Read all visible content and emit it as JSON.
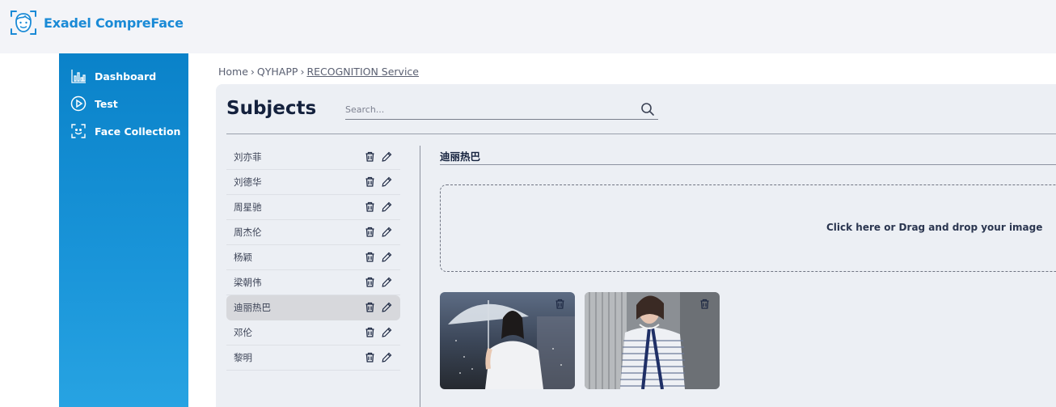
{
  "app": {
    "brand_name": "Exadel CompreFace",
    "brand_color": "#1a8ad6"
  },
  "sidebar": {
    "items": [
      {
        "label": "Dashboard",
        "icon": "chart-icon"
      },
      {
        "label": "Test",
        "icon": "play-icon"
      },
      {
        "label": "Face Collection",
        "icon": "face-scan-icon"
      }
    ]
  },
  "breadcrumb": {
    "home": "Home",
    "app": "QYHAPP",
    "service": "RECOGNITION Service",
    "separator": "›"
  },
  "subjects": {
    "title": "Subjects",
    "search_placeholder": "Search...",
    "items": [
      {
        "name": "刘亦菲"
      },
      {
        "name": "刘德华"
      },
      {
        "name": "周星驰"
      },
      {
        "name": "周杰伦"
      },
      {
        "name": "杨颖"
      },
      {
        "name": "梁朝伟"
      },
      {
        "name": "迪丽热巴"
      },
      {
        "name": "邓伦"
      },
      {
        "name": "黎明"
      }
    ],
    "selected_index": 6
  },
  "detail": {
    "subject_name": "迪丽热巴",
    "dropzone_text": "Click here or Drag and drop your image",
    "images": [
      {
        "description": "woman-with-umbrella-photo"
      },
      {
        "description": "woman-in-striped-jacket-photo"
      }
    ]
  }
}
